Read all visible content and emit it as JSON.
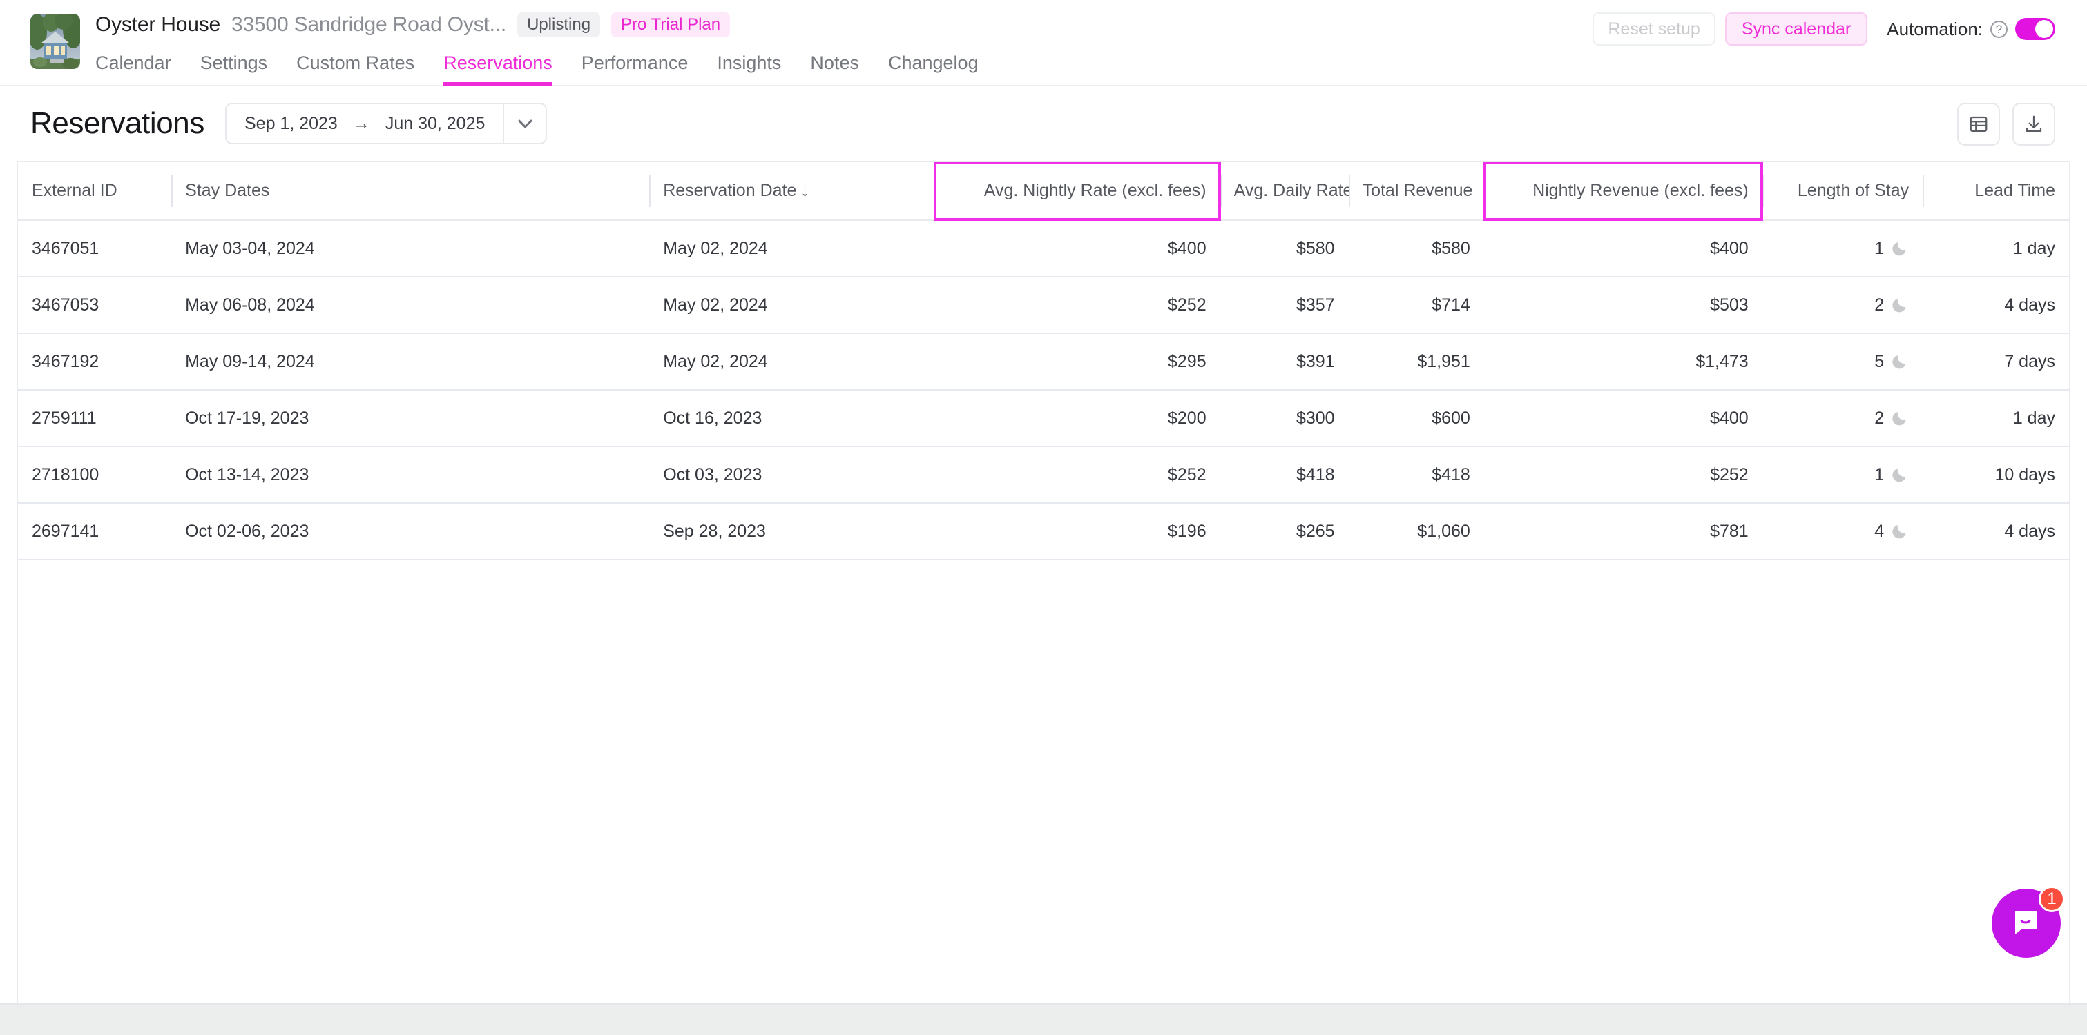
{
  "header": {
    "property_name": "Oyster House",
    "property_address": "33500 Sandridge Road Oyst...",
    "badges": [
      {
        "label": "Uplisting",
        "style": "gray"
      },
      {
        "label": "Pro Trial Plan",
        "style": "pink"
      }
    ],
    "nav": [
      {
        "label": "Calendar",
        "active": false
      },
      {
        "label": "Settings",
        "active": false
      },
      {
        "label": "Custom Rates",
        "active": false
      },
      {
        "label": "Reservations",
        "active": true
      },
      {
        "label": "Performance",
        "active": false
      },
      {
        "label": "Insights",
        "active": false
      },
      {
        "label": "Notes",
        "active": false
      },
      {
        "label": "Changelog",
        "active": false
      }
    ],
    "reset_setup_label": "Reset setup",
    "sync_calendar_label": "Sync calendar",
    "automation_label": "Automation:",
    "automation_enabled": true,
    "thumbnail_icon": "property-photo-cabin"
  },
  "pagehead": {
    "title": "Reservations",
    "date_from": "Sep 1, 2023",
    "date_to": "Jun 30, 2025",
    "range_arrow": "→",
    "caret_icon": "chevron-down-icon",
    "table_view_icon": "table-icon",
    "export_icon": "download-icon"
  },
  "table": {
    "columns": [
      {
        "label": "External ID",
        "align": "left",
        "highlight": false,
        "sorted": false
      },
      {
        "label": "Stay Dates",
        "align": "left",
        "highlight": false,
        "sorted": false
      },
      {
        "label": "Reservation Date",
        "align": "left",
        "highlight": false,
        "sorted": true,
        "sort_dir": "↓"
      },
      {
        "label": "Avg. Nightly Rate (excl. fees)",
        "align": "right",
        "highlight": true,
        "sorted": false
      },
      {
        "label": "Avg. Daily Rate",
        "align": "right",
        "highlight": false,
        "sorted": false
      },
      {
        "label": "Total Revenue",
        "align": "right",
        "highlight": false,
        "sorted": false
      },
      {
        "label": "Nightly Revenue (excl. fees)",
        "align": "right",
        "highlight": true,
        "sorted": false
      },
      {
        "label": "Length of Stay",
        "align": "right",
        "highlight": false,
        "sorted": false
      },
      {
        "label": "Lead Time",
        "align": "right",
        "highlight": false,
        "sorted": false
      }
    ],
    "rows": [
      {
        "external_id": "3467051",
        "stay_dates": "May 03-04, 2024",
        "reservation_date": "May 02, 2024",
        "avg_nightly_rate": "$400",
        "avg_daily_rate": "$580",
        "total_revenue": "$580",
        "nightly_revenue": "$400",
        "length_of_stay": "1",
        "lead_time": "1 day"
      },
      {
        "external_id": "3467053",
        "stay_dates": "May 06-08, 2024",
        "reservation_date": "May 02, 2024",
        "avg_nightly_rate": "$252",
        "avg_daily_rate": "$357",
        "total_revenue": "$714",
        "nightly_revenue": "$503",
        "length_of_stay": "2",
        "lead_time": "4 days"
      },
      {
        "external_id": "3467192",
        "stay_dates": "May 09-14, 2024",
        "reservation_date": "May 02, 2024",
        "avg_nightly_rate": "$295",
        "avg_daily_rate": "$391",
        "total_revenue": "$1,951",
        "nightly_revenue": "$1,473",
        "length_of_stay": "5",
        "lead_time": "7 days"
      },
      {
        "external_id": "2759111",
        "stay_dates": "Oct 17-19, 2023",
        "reservation_date": "Oct 16, 2023",
        "avg_nightly_rate": "$200",
        "avg_daily_rate": "$300",
        "total_revenue": "$600",
        "nightly_revenue": "$400",
        "length_of_stay": "2",
        "lead_time": "1 day"
      },
      {
        "external_id": "2718100",
        "stay_dates": "Oct 13-14, 2023",
        "reservation_date": "Oct 03, 2023",
        "avg_nightly_rate": "$252",
        "avg_daily_rate": "$418",
        "total_revenue": "$418",
        "nightly_revenue": "$252",
        "length_of_stay": "1",
        "lead_time": "10 days"
      },
      {
        "external_id": "2697141",
        "stay_dates": "Oct 02-06, 2023",
        "reservation_date": "Sep 28, 2023",
        "avg_nightly_rate": "$196",
        "avg_daily_rate": "$265",
        "total_revenue": "$1,060",
        "nightly_revenue": "$781",
        "length_of_stay": "4",
        "lead_time": "4 days"
      }
    ],
    "moon_icon": "moon-icon"
  },
  "intercom": {
    "icon": "chat-bubble-icon",
    "unread_count": "1"
  },
  "colors": {
    "accent": "#ef2bd8",
    "highlight_border": "#f22fe8",
    "badge_pink_bg": "#fde9fa",
    "badge_gray_bg": "#f1f1f3",
    "toggle_on": "#e212e0",
    "intercom_bg": "#c215e8",
    "intercom_badge": "#fa4d3d"
  }
}
